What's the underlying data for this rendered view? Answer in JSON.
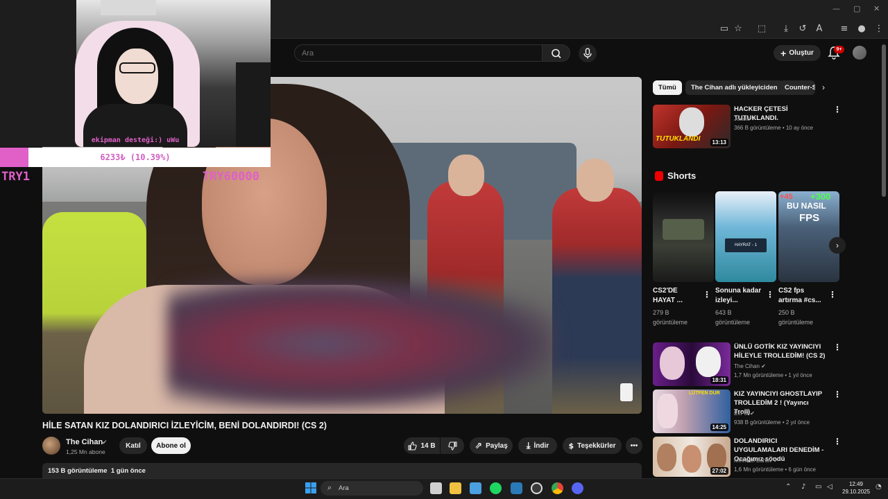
{
  "overlay": {
    "caption": "ekipman desteği:) uWu",
    "donation_text": "6233₺ (10.39%)",
    "donation_progress": 0.1039,
    "try_left": "TRY1",
    "try_right": "TRY60000"
  },
  "search": {
    "placeholder": "Ara"
  },
  "header": {
    "create_label": "Oluştur",
    "notification_count": "9+"
  },
  "video": {
    "title": "HİLE SATAN KIZ DOLANDIRICI İZLEYİCİM, BENİ DOLANDIRDI! (CS 2)",
    "channel": "The Cihan",
    "subscribers": "1,25 Mn abone",
    "join_label": "Katıl",
    "subscribe_label": "Abone ol",
    "likes": "14 B",
    "share_label": "Paylaş",
    "download_label": "İndir",
    "thanks_label": "Teşekkürler",
    "views": "153 B görüntüleme",
    "age": "1 gün önce"
  },
  "chips": [
    "Tümü",
    "The Cihan adlı yükleyiciden",
    "Counter-S"
  ],
  "recommendations_top": [
    {
      "title": "HACKER ÇETESİ TUTUKLANDI.",
      "channel": "Juadis",
      "meta": "366 B görüntüleme • 10 ay önce",
      "duration": "13:13",
      "thumb_text": "TUTUKLANDI"
    }
  ],
  "shorts": {
    "heading": "Shorts",
    "items": [
      {
        "title": "CS2'DE HAYAT ...",
        "views": "279 B görüntüleme"
      },
      {
        "title": "Sonuna kadar izleyi...",
        "views": "643 B görüntüleme"
      },
      {
        "title": "CS2 fps artırma #cs...",
        "views": "250 B görüntüleme"
      }
    ],
    "thumb_texts": [
      "BU NASIL",
      "FPS",
      "+300",
      "+45",
      "HAYRAT - 1"
    ]
  },
  "recommendations": [
    {
      "title": "ÜNLÜ GOTİK KIZ YAYINCIYI HİLEYLE TROLLEDİM! (CS 2)",
      "channel": "The Cihan",
      "meta": "1,7 Mn görüntüleme • 1 yıl önce",
      "duration": "18:31"
    },
    {
      "title": "KIZ YAYINCIYI GHOSTLAYIP TROLLEDİM 2 ! (Yayıncı Troll)",
      "channel": "ExPol",
      "meta": "938 B görüntüleme • 2 yıl önce",
      "duration": "14:25",
      "thumb_text": "LÜTFEN DUR"
    },
    {
      "title": "DOLANDIRICI UYGULAMALARI DENEDİM - Ocağımız söndü",
      "channel": "Mevlcan Bahav",
      "meta": "1,6 Mn görüntüleme • 6 gün önce",
      "duration": "27:02"
    }
  ],
  "taskbar": {
    "search_label": "Ara",
    "time": "12:49",
    "date": "29.10.2025"
  },
  "colors": {
    "accent_pink": "#e060c8",
    "bg": "#0f0f0f",
    "chip": "#272727",
    "badge_red": "#cc0000"
  },
  "icons": [
    "search-icon",
    "mic-icon",
    "plus-icon",
    "bell-icon",
    "like-icon",
    "dislike-icon",
    "share-icon",
    "download-icon",
    "thanks-icon",
    "more-icon",
    "verified-icon",
    "chevron-right-icon",
    "windows-icon"
  ]
}
